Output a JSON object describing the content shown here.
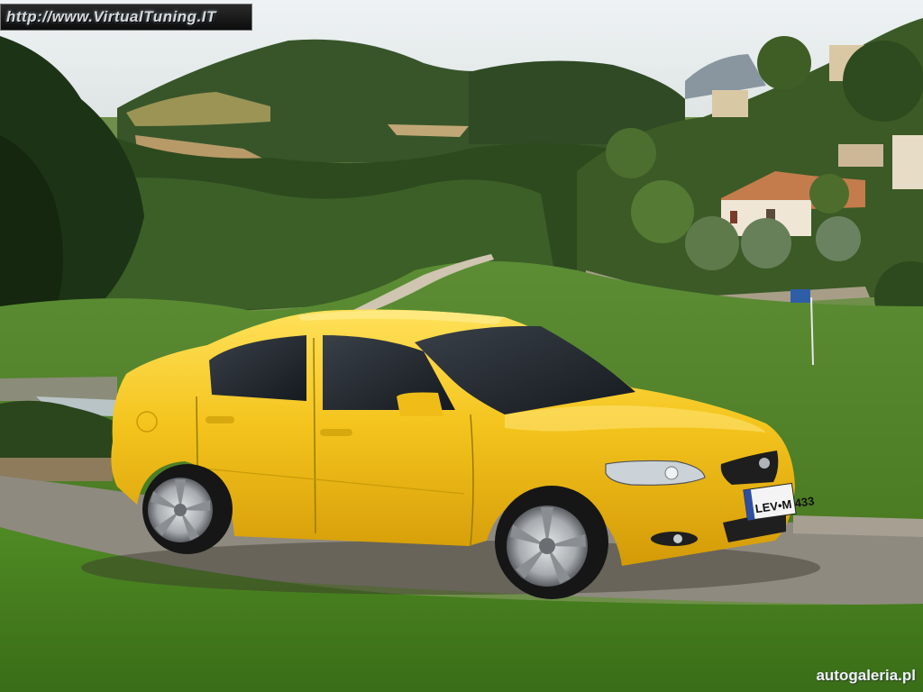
{
  "overlay": {
    "top_left_url": "http://www.VirtualTuning.IT",
    "bottom_right_credit": "autogaleria.pl"
  },
  "car": {
    "color": "#f2c21c",
    "license_plate": "LEV•M 433"
  },
  "colors": {
    "sky": "#e9eef0",
    "grass": "#4f7f25",
    "road": "#9a9488"
  }
}
